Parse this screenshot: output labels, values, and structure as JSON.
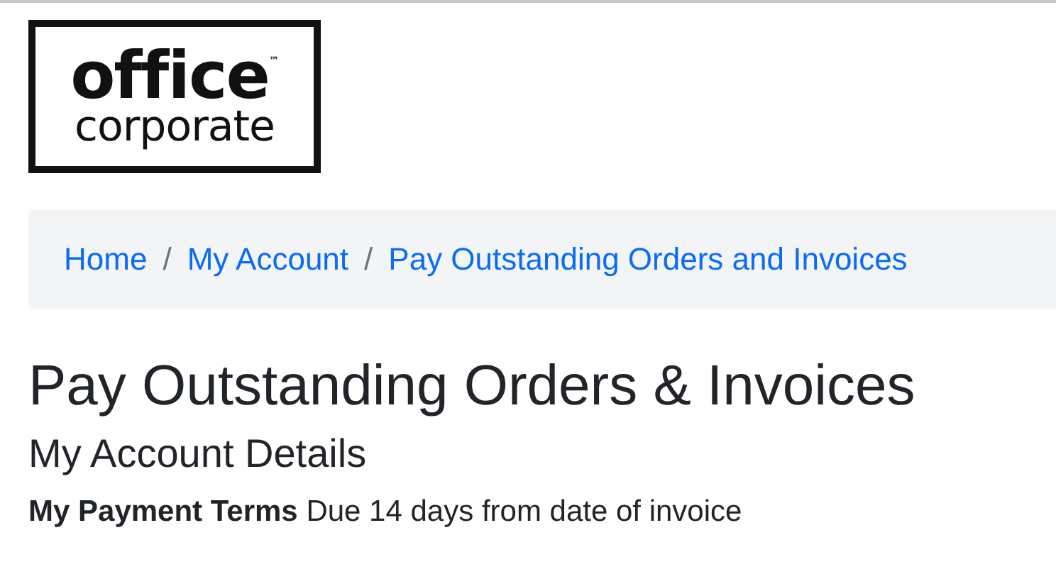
{
  "logo": {
    "line_1": "office",
    "mark": "™",
    "line_2": "corporate"
  },
  "breadcrumb": [
    {
      "label": "Home"
    },
    {
      "label": "My Account"
    },
    {
      "label": "Pay Outstanding Orders and Invoices"
    }
  ],
  "breadcrumb_separator": "/",
  "title": "Pay Outstanding Orders & Invoices",
  "subtitle": "My Account Details",
  "terms": {
    "label": "My Payment Terms",
    "value": "Due 14 days from date of invoice"
  }
}
